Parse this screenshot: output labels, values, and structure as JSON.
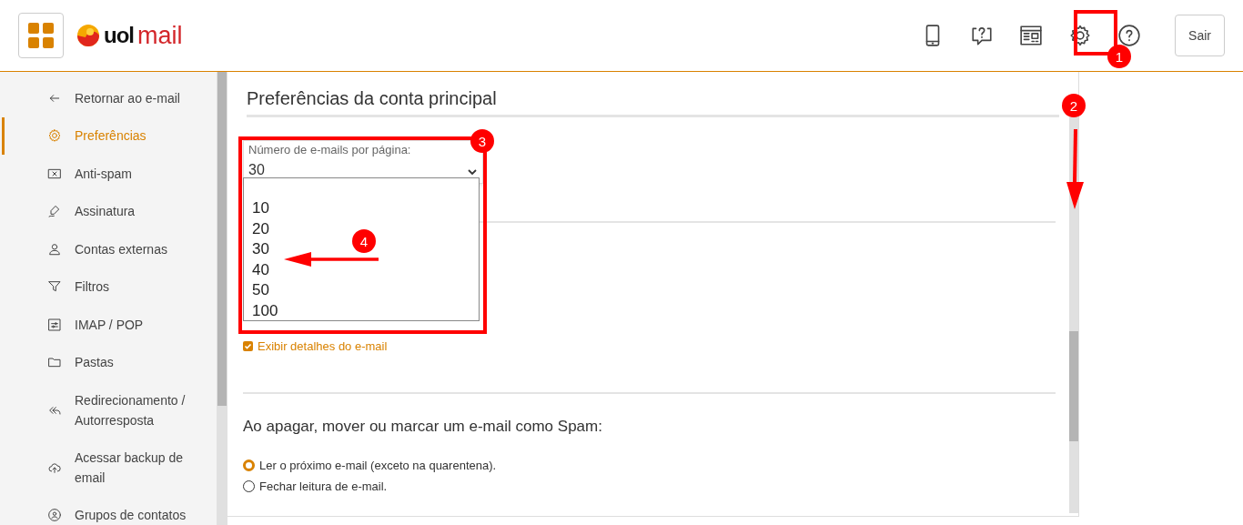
{
  "header": {
    "logo": {
      "brand": "uol",
      "product": "mail"
    },
    "logout": "Sair"
  },
  "sidebar": {
    "items": [
      {
        "label": "Retornar ao e-mail",
        "selected": false
      },
      {
        "label": "Preferências",
        "selected": true
      },
      {
        "label": "Anti-spam",
        "selected": false
      },
      {
        "label": "Assinatura",
        "selected": false
      },
      {
        "label": "Contas externas",
        "selected": false
      },
      {
        "label": "Filtros",
        "selected": false
      },
      {
        "label": "IMAP / POP",
        "selected": false
      },
      {
        "label": "Pastas",
        "selected": false
      },
      {
        "label": "Redirecionamento / Autorresposta",
        "selected": false
      },
      {
        "label": "Acessar backup de email",
        "selected": false
      },
      {
        "label": "Grupos de contatos",
        "selected": false
      }
    ]
  },
  "main": {
    "title": "Preferências da conta principal",
    "select": {
      "label": "Número de e-mails por página:",
      "value": "30",
      "expanded": true,
      "options": [
        "10",
        "20",
        "30",
        "40",
        "50",
        "100"
      ]
    },
    "checkbox": {
      "label": "Exibir detalhes do e-mail",
      "checked": true
    },
    "section": {
      "heading": "Ao apagar, mover ou marcar um e-mail como Spam:",
      "options": [
        {
          "label": "Ler o próximo e-mail (exceto na quarentena).",
          "selected": true
        },
        {
          "label": "Fechar leitura de e-mail.",
          "selected": false
        }
      ]
    }
  },
  "annotations": [
    {
      "number": "1"
    },
    {
      "number": "2"
    },
    {
      "number": "3"
    },
    {
      "number": "4"
    }
  ]
}
